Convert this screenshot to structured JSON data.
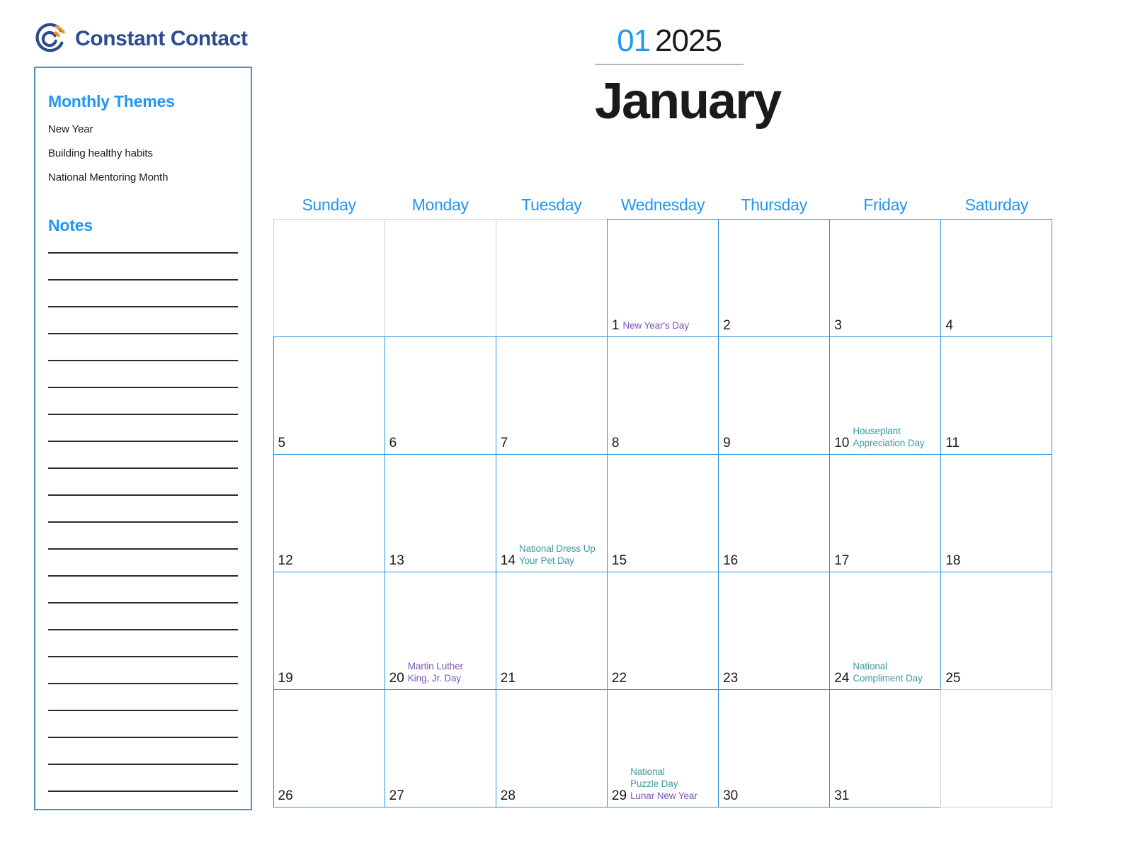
{
  "brand": {
    "name": "Constant Contact",
    "logo_icon": "constant-contact-swirl-logo",
    "logo_color": "#2e4b8f",
    "logo_accent_color": "#f7941e"
  },
  "theme_colors": {
    "primary_blue": "#2196f3",
    "grid_blue": "#2a8fe0",
    "outside_gray": "#d0d0d0",
    "event_teal": "#3f9aa0",
    "event_purple": "#7a53b8",
    "brand_navy": "#2e4b8f"
  },
  "sidebar": {
    "themes_heading": "Monthly Themes",
    "themes": [
      "New Year",
      "Building healthy habits",
      "National Mentoring Month"
    ],
    "notes_heading": "Notes",
    "notes_line_count": 21
  },
  "title": {
    "month_number": "01",
    "year": "2025",
    "month_name": "January"
  },
  "calendar": {
    "weekdays": [
      "Sunday",
      "Monday",
      "Tuesday",
      "Wednesday",
      "Thursday",
      "Friday",
      "Saturday"
    ],
    "cells": [
      {
        "day": "",
        "outside": true,
        "events": []
      },
      {
        "day": "",
        "outside": true,
        "events": []
      },
      {
        "day": "",
        "outside": true,
        "events": []
      },
      {
        "day": "1",
        "outside": false,
        "events": [
          {
            "text": "New Year's Day",
            "color": "purple"
          }
        ]
      },
      {
        "day": "2",
        "outside": false,
        "events": []
      },
      {
        "day": "3",
        "outside": false,
        "events": []
      },
      {
        "day": "4",
        "outside": false,
        "events": []
      },
      {
        "day": "5",
        "outside": false,
        "events": []
      },
      {
        "day": "6",
        "outside": false,
        "events": []
      },
      {
        "day": "7",
        "outside": false,
        "events": []
      },
      {
        "day": "8",
        "outside": false,
        "events": []
      },
      {
        "day": "9",
        "outside": false,
        "events": []
      },
      {
        "day": "10",
        "outside": false,
        "events": [
          {
            "text": "Houseplant",
            "color": "teal"
          },
          {
            "text": "Appreciation Day",
            "color": "teal"
          }
        ]
      },
      {
        "day": "11",
        "outside": false,
        "events": []
      },
      {
        "day": "12",
        "outside": false,
        "events": []
      },
      {
        "day": "13",
        "outside": false,
        "events": []
      },
      {
        "day": "14",
        "outside": false,
        "events": [
          {
            "text": "National Dress Up",
            "color": "teal"
          },
          {
            "text": "Your Pet Day",
            "color": "teal"
          }
        ]
      },
      {
        "day": "15",
        "outside": false,
        "events": []
      },
      {
        "day": "16",
        "outside": false,
        "events": []
      },
      {
        "day": "17",
        "outside": false,
        "events": []
      },
      {
        "day": "18",
        "outside": false,
        "events": []
      },
      {
        "day": "19",
        "outside": false,
        "events": []
      },
      {
        "day": "20",
        "outside": false,
        "events": [
          {
            "text": "Martin Luther",
            "color": "purple"
          },
          {
            "text": "King, Jr. Day",
            "color": "purple"
          }
        ]
      },
      {
        "day": "21",
        "outside": false,
        "events": []
      },
      {
        "day": "22",
        "outside": false,
        "events": []
      },
      {
        "day": "23",
        "outside": false,
        "events": []
      },
      {
        "day": "24",
        "outside": false,
        "events": [
          {
            "text": "National",
            "color": "teal"
          },
          {
            "text": "Compliment Day",
            "color": "teal"
          }
        ]
      },
      {
        "day": "25",
        "outside": false,
        "events": []
      },
      {
        "day": "26",
        "outside": false,
        "events": []
      },
      {
        "day": "27",
        "outside": false,
        "events": []
      },
      {
        "day": "28",
        "outside": false,
        "events": []
      },
      {
        "day": "29",
        "outside": false,
        "events": [
          {
            "text": "National",
            "color": "teal"
          },
          {
            "text": "Puzzle Day",
            "color": "teal"
          },
          {
            "text": "Lunar New Year",
            "color": "purple"
          }
        ]
      },
      {
        "day": "30",
        "outside": false,
        "events": []
      },
      {
        "day": "31",
        "outside": false,
        "events": []
      },
      {
        "day": "",
        "outside": true,
        "events": []
      }
    ]
  }
}
